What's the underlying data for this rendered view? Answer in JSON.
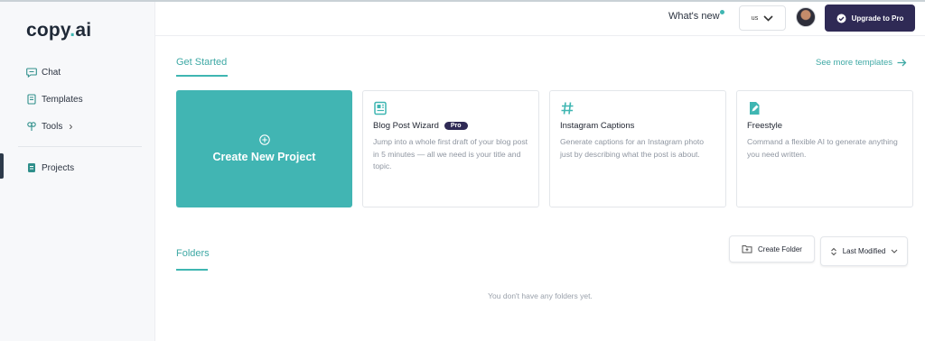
{
  "brand": {
    "name_left": "copy",
    "name_dot": ".",
    "name_right": "ai"
  },
  "sidebar": {
    "items": [
      {
        "label": "Chat",
        "icon": "chat-icon"
      },
      {
        "label": "Templates",
        "icon": "document-icon"
      },
      {
        "label": "Tools",
        "icon": "tools-icon",
        "suffix": "›"
      },
      {
        "label": "Projects",
        "icon": "projects-icon",
        "active": true
      }
    ]
  },
  "header": {
    "whats_new": "What's new",
    "language": "us",
    "upgrade_label": "Upgrade to Pro"
  },
  "get_started": {
    "title": "Get Started",
    "see_more": "See more templates",
    "create_label": "Create New Project",
    "templates": [
      {
        "name": "Blog Post Wizard",
        "badge": "Pro",
        "icon": "newspaper-icon",
        "description": "Jump into a whole first draft of your blog post in 5 minutes — all we need is your title and topic."
      },
      {
        "name": "Instagram Captions",
        "badge": "",
        "icon": "hashtag-icon",
        "description": "Generate captions for an Instagram photo just by describing what the post is about."
      },
      {
        "name": "Freestyle",
        "badge": "",
        "icon": "file-edit-icon",
        "description": "Command a flexible AI to generate anything you need written."
      }
    ]
  },
  "folders": {
    "title": "Folders",
    "create_label": "Create Folder",
    "sort_label": "Last Modified",
    "empty_text": "You don't have any folders yet."
  },
  "colors": {
    "accent": "#3fb6b2",
    "brand_dark": "#2f2a55"
  }
}
